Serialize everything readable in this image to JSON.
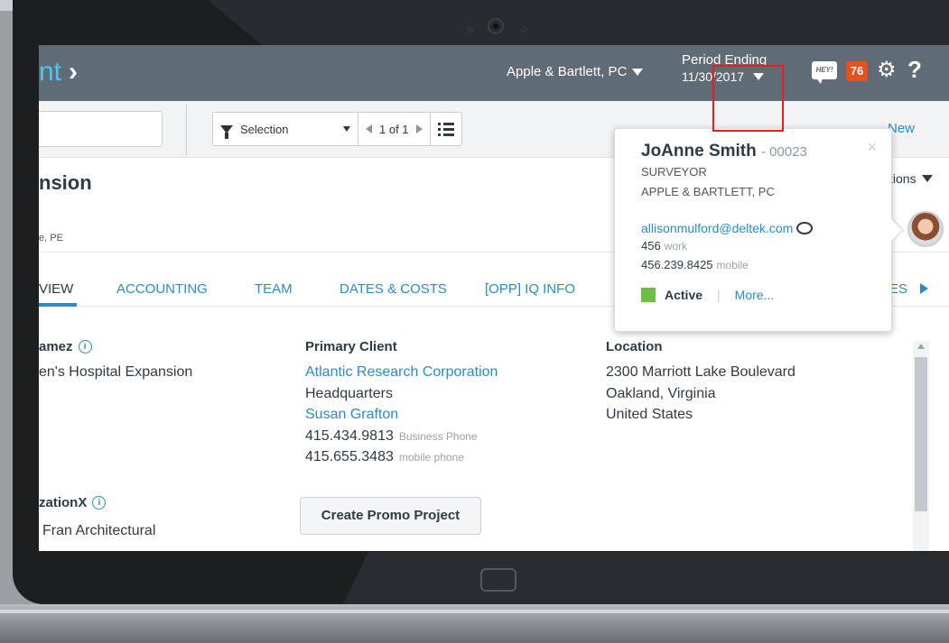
{
  "header": {
    "app_title": "nt",
    "company": "Apple & Bartlett, PC",
    "period_label": "Period Ending",
    "period_date": "11/30/2017",
    "hey_label": "HEY!",
    "notification_count": "76"
  },
  "toolbar": {
    "filter_label": "Selection",
    "pager": "1 of 1",
    "new_label": "New"
  },
  "record": {
    "title": "nsion",
    "subtitle": "e, PE",
    "options_label": "tions"
  },
  "tabs": [
    "VIEW",
    "ACCOUNTING",
    "TEAM",
    "DATES & COSTS",
    "[OPP] IQ INFO",
    "ES"
  ],
  "fields": {
    "name_label": "amez",
    "name_value": "en's Hospital Expansion",
    "primary_client_label": "Primary Client",
    "client_name": "Atlantic Research Corporation",
    "client_office": "Headquarters",
    "contact_name": "Susan Grafton",
    "phone1": "415.434.9813",
    "phone1_type": "Business Phone",
    "phone2": "415.655.3483",
    "phone2_type": "mobile phone",
    "location_label": "Location",
    "address1": "2300 Marriott Lake Boulevard",
    "address2": "Oakland, Virginia",
    "address3": "United States",
    "org_label": "zationX",
    "org_value": "Fran Architectural",
    "promo_button": "Create Promo Project"
  },
  "popup": {
    "name": "JoAnne Smith",
    "id": "- 00023",
    "role": "SURVEYOR",
    "company": "APPLE & BARTLETT, PC",
    "email": "allisonmulford@deltek.com",
    "work_number": "456",
    "work_label": "work",
    "mobile_number": "456.239.8425",
    "mobile_label": "mobile",
    "status": "Active",
    "more": "More...",
    "close": "×",
    "status_color": "#6cbd45"
  },
  "colors": {
    "accent": "#2b8bc6",
    "header_bg": "#5f6b75",
    "badge": "#e8501c",
    "highlight": "#ef1c1c"
  }
}
